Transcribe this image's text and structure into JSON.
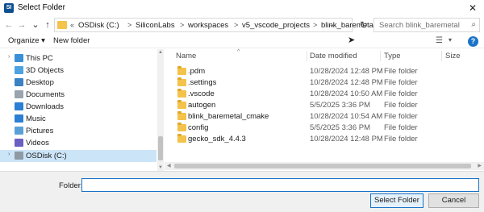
{
  "window": {
    "title": "Select Folder",
    "app_icon_text": "SI",
    "close_label": "✕"
  },
  "nav_buttons": {
    "back": "←",
    "forward": "→",
    "dropdown": "⌄",
    "up": "↑"
  },
  "address": {
    "chevron": "«",
    "segments": [
      "OSDisk (C:)",
      "SiliconLabs",
      "workspaces",
      "v5_vscode_projects",
      "blink_baremetal"
    ],
    "separator": ">",
    "dropdown": "⌄",
    "refresh": "↻"
  },
  "search": {
    "placeholder": "Search blink_baremetal",
    "icon": "⌕"
  },
  "toolbar": {
    "organize_label": "Organize ▾",
    "new_folder_label": "New folder",
    "view_icon": "☰",
    "view_dropdown": "▾",
    "help_label": "?"
  },
  "nav_pane": {
    "items": [
      {
        "label": "This PC",
        "icon": "pc-icon",
        "color": "#3a8fd8",
        "expand": "›"
      },
      {
        "label": "3D Objects",
        "icon": "cube-icon",
        "color": "#4da3e0",
        "expand": "›"
      },
      {
        "label": "Desktop",
        "icon": "desktop-icon",
        "color": "#3b82c4",
        "expand": "›"
      },
      {
        "label": "Documents",
        "icon": "documents-icon",
        "color": "#9aa4ae",
        "expand": "›"
      },
      {
        "label": "Downloads",
        "icon": "downloads-icon",
        "color": "#2b7fd4",
        "expand": "›"
      },
      {
        "label": "Music",
        "icon": "music-icon",
        "color": "#2b7fd4",
        "expand": "›"
      },
      {
        "label": "Pictures",
        "icon": "pictures-icon",
        "color": "#5aa0d8",
        "expand": "›"
      },
      {
        "label": "Videos",
        "icon": "videos-icon",
        "color": "#6a5fc2",
        "expand": "›"
      },
      {
        "label": "OSDisk (C:)",
        "icon": "drive-icon",
        "color": "#8f9aa4",
        "expand": "›"
      }
    ]
  },
  "list": {
    "columns": {
      "name": "Name",
      "date": "Date modified",
      "type": "Type",
      "size": "Size"
    },
    "sort_caret": "^",
    "rows": [
      {
        "name": ".pdm",
        "date": "10/28/2024 12:48 PM",
        "type": "File folder"
      },
      {
        "name": ".settings",
        "date": "10/28/2024 12:48 PM",
        "type": "File folder"
      },
      {
        "name": ".vscode",
        "date": "10/28/2024 10:50 AM",
        "type": "File folder"
      },
      {
        "name": "autogen",
        "date": "5/5/2025 3:36 PM",
        "type": "File folder"
      },
      {
        "name": "blink_baremetal_cmake",
        "date": "10/28/2024 10:54 AM",
        "type": "File folder"
      },
      {
        "name": "config",
        "date": "5/5/2025 3:36 PM",
        "type": "File folder"
      },
      {
        "name": "gecko_sdk_4.4.3",
        "date": "10/28/2024 12:48 PM",
        "type": "File folder"
      }
    ]
  },
  "footer": {
    "folder_label": "Folder:",
    "folder_value": "",
    "select_button": "Select Folder",
    "cancel_button": "Cancel"
  },
  "colors": {
    "accent": "#1a73c8",
    "selection": "#cce4f7",
    "folder": "#f3c34b"
  }
}
